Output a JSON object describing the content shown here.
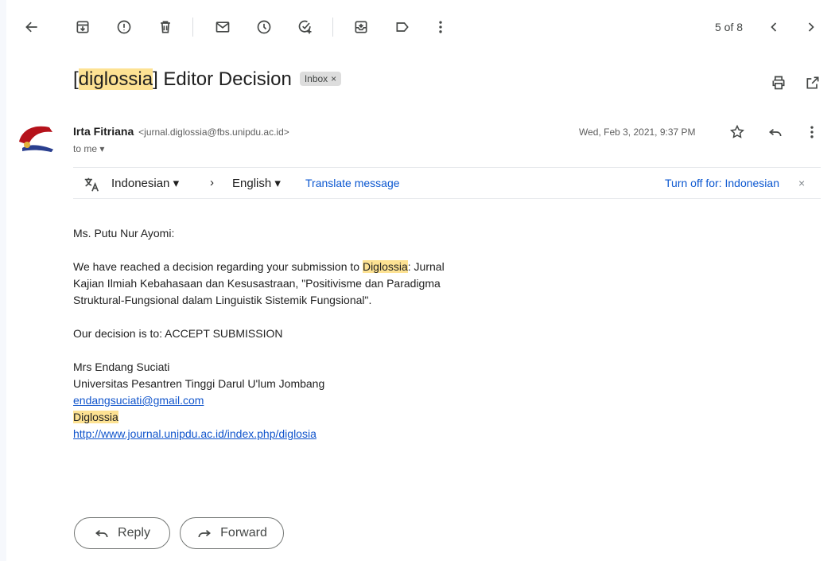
{
  "toolbar": {
    "icons": [
      "back-arrow-icon",
      "archive-icon",
      "report-spam-icon",
      "delete-icon",
      "mark-unread-icon",
      "snooze-icon",
      "add-task-icon",
      "move-to-icon",
      "label-icon",
      "more-vert-icon",
      "newer-icon",
      "older-icon"
    ],
    "counter": "5 of 8"
  },
  "subject": {
    "prefix": "[",
    "highlight": "diglossia",
    "rest": "] Editor Decision",
    "label": "Inbox",
    "label_close": "×"
  },
  "sender": {
    "name": "Irta Fitriana",
    "email": "<jurnal.diglossia@fbs.unipdu.ac.id>",
    "to": "to me",
    "date": "Wed, Feb 3, 2021, 9:37 PM"
  },
  "translate": {
    "from_lang": "Indonesian",
    "to_lang": "English",
    "action": "Translate message",
    "turn_off": "Turn off for: Indonesian",
    "close": "×"
  },
  "message": {
    "greeting": "Ms. Putu Nur Ayomi:",
    "p1_before": "We have reached a decision regarding your submission to ",
    "p1_highlight": "Diglossia",
    "p1_after1": ": Jurnal",
    "p1_line2": "Kajian Ilmiah Kebahasaan dan Kesusastraan, \"Positivisme dan Paradigma",
    "p1_line3": "Struktural-Fungsional dalam Linguistik Sistemik Fungsional\".",
    "decision": "Our decision is to: ACCEPT SUBMISSION",
    "sig_name": "Mrs Endang Suciati",
    "sig_org": "Universitas Pesantren Tinggi Darul U'lum Jombang",
    "sig_email": "endangsuciati@gmail.com",
    "sig_journal": "Diglossia",
    "sig_url": "http://www.journal.unipdu.ac.id/index.php/diglosia"
  },
  "actions": {
    "reply": "Reply",
    "forward": "Forward"
  },
  "colors": {
    "highlight": "#fde293",
    "link": "#1155cc",
    "translate_link": "#0b57d0"
  }
}
